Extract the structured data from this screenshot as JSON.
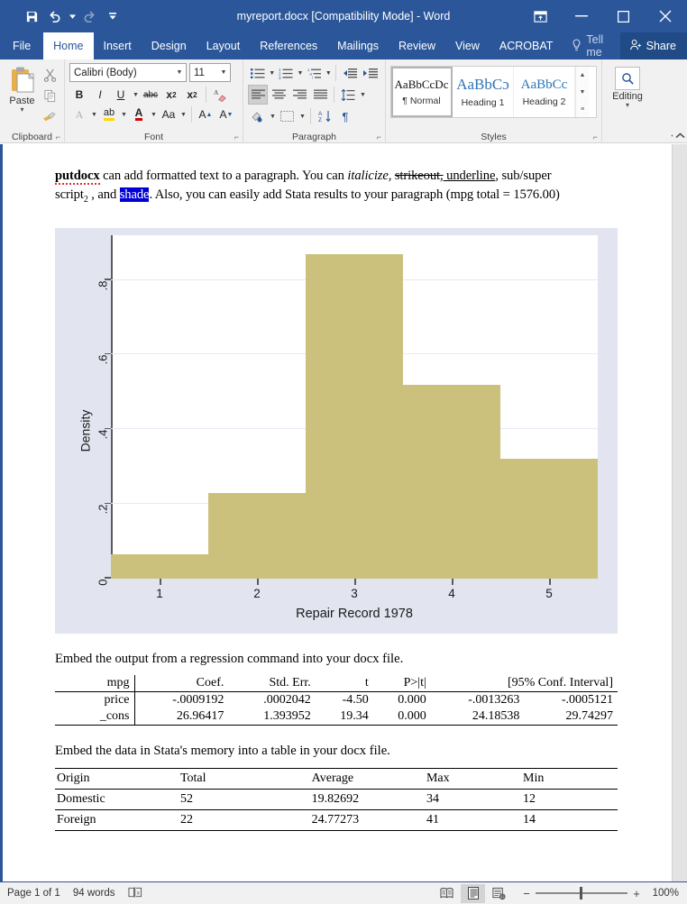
{
  "titlebar": {
    "document_title": "myreport.docx [Compatibility Mode]  -  Word",
    "qat": [
      {
        "name": "save-icon",
        "label": "Save"
      },
      {
        "name": "undo-icon",
        "label": "Undo"
      },
      {
        "name": "redo-icon",
        "label": "Redo"
      },
      {
        "name": "customize-quick-access-toolbar-icon",
        "label": "Customize Quick Access Toolbar"
      }
    ],
    "window_controls": [
      {
        "name": "ribbon-display-options-icon",
        "label": "Ribbon Display Options"
      },
      {
        "name": "minimize-icon",
        "label": "Minimize"
      },
      {
        "name": "maximize-icon",
        "label": "Maximize"
      },
      {
        "name": "close-icon",
        "label": "Close"
      }
    ]
  },
  "tabs": {
    "items": [
      {
        "label": "File",
        "active": false
      },
      {
        "label": "Home",
        "active": true
      },
      {
        "label": "Insert",
        "active": false
      },
      {
        "label": "Design",
        "active": false
      },
      {
        "label": "Layout",
        "active": false
      },
      {
        "label": "References",
        "active": false
      },
      {
        "label": "Mailings",
        "active": false
      },
      {
        "label": "Review",
        "active": false
      },
      {
        "label": "View",
        "active": false
      },
      {
        "label": "ACROBAT",
        "active": false
      }
    ],
    "tell_me": "Tell me",
    "share": "Share"
  },
  "ribbon": {
    "groups": [
      {
        "label": "Clipboard"
      },
      {
        "label": "Font"
      },
      {
        "label": "Paragraph"
      },
      {
        "label": "Styles"
      }
    ],
    "clipboard": {
      "paste_label": "Paste",
      "buttons": [
        "cut-icon",
        "copy-icon",
        "format-painter-icon"
      ]
    },
    "font": {
      "font_name": "Calibri (Body)",
      "font_size": "11",
      "buttons": [
        "bold",
        "italic",
        "underline",
        "strikethrough",
        "subscript",
        "superscript",
        "clear-formatting",
        "text-effects",
        "text-highlight-color",
        "font-color",
        "change-case",
        "grow-font",
        "shrink-font"
      ]
    },
    "paragraph": {
      "buttons": [
        "bullets",
        "numbering",
        "multilevel-list",
        "decrease-indent",
        "increase-indent",
        "align-left",
        "center",
        "align-right",
        "justify",
        "line-spacing",
        "shading",
        "borders",
        "sort",
        "show-formatting-marks"
      ]
    },
    "styles": {
      "items": [
        {
          "preview": "AaBbCcDc",
          "name": "¶ Normal",
          "selected": true
        },
        {
          "preview": "AaBbCɔ",
          "name": "Heading 1",
          "selected": false
        },
        {
          "preview": "AaBbCc",
          "name": "Heading 2",
          "selected": false
        }
      ]
    },
    "editing": {
      "label": "Editing"
    }
  },
  "document": {
    "paragraph1": {
      "s1": "putdocx",
      "s2": " can add formatted text to a paragraph.  You can ",
      "s3": "italicize,",
      "s4": " ",
      "s5": "strikeout,",
      "s6": " underline",
      "s7": ", sub/super",
      "s8": "script",
      "s9": "2",
      "s10": " , and ",
      "s11": "shade",
      "s12": ".  Also, you can easily add Stata results to your paragraph (mpg total = 1576.00)"
    },
    "caption_regression": "Embed the output from a regression command into your docx file.",
    "caption_data": "Embed the data in Stata's memory into a table in your docx file.",
    "regression_table": {
      "headers": [
        "mpg",
        "Coef.",
        "Std. Err.",
        "t",
        "P>|t|",
        "[95% Conf. Interval]"
      ],
      "rows": [
        {
          "var": "price",
          "coef": "-.0009192",
          "se": ".0002042",
          "t": "-4.50",
          "p": "0.000",
          "ci_low": "-.0013263",
          "ci_high": "-.0005121"
        },
        {
          "var": "_cons",
          "coef": "26.96417",
          "se": "1.393952",
          "t": "19.34",
          "p": "0.000",
          "ci_low": "24.18538",
          "ci_high": "29.74297"
        }
      ]
    },
    "data_table": {
      "headers": [
        "Origin",
        "Total",
        "Average",
        "Max",
        "Min"
      ],
      "rows": [
        [
          "Domestic",
          "52",
          "19.82692",
          "34",
          "12"
        ],
        [
          "Foreign",
          "22",
          "24.77273",
          "41",
          "14"
        ]
      ]
    }
  },
  "chart_data": {
    "type": "bar",
    "title": "",
    "categories": [
      "1",
      "2",
      "3",
      "4",
      "5"
    ],
    "values": [
      0.065,
      0.23,
      0.87,
      0.52,
      0.32
    ],
    "xlabel": "Repair Record 1978",
    "ylabel": "Density",
    "xlim": [
      0.5,
      5.5
    ],
    "ylim": [
      0,
      0.92
    ],
    "yticks": [
      0,
      0.2,
      0.4,
      0.6,
      0.8
    ],
    "ytick_labels": [
      "0",
      ".2",
      ".4",
      ".6",
      ".8"
    ],
    "xticks": [
      1,
      2,
      3,
      4,
      5
    ],
    "xtick_labels": [
      "1",
      "2",
      "3",
      "4",
      "5"
    ],
    "grid": true,
    "legend": "none",
    "bar_color": "#cbc17d",
    "plot_bg": "#ffffff",
    "figure_bg": "#e2e5f0"
  },
  "statusbar": {
    "page": "Page 1 of 1",
    "words": "94 words",
    "proofing_icon": "proofing-errors-icon",
    "views": [
      {
        "name": "read-mode-icon",
        "active": false
      },
      {
        "name": "print-layout-icon",
        "active": true
      },
      {
        "name": "web-layout-icon",
        "active": false
      }
    ],
    "zoom_out": "−",
    "zoom_in": "+",
    "zoom_value": "100%"
  }
}
